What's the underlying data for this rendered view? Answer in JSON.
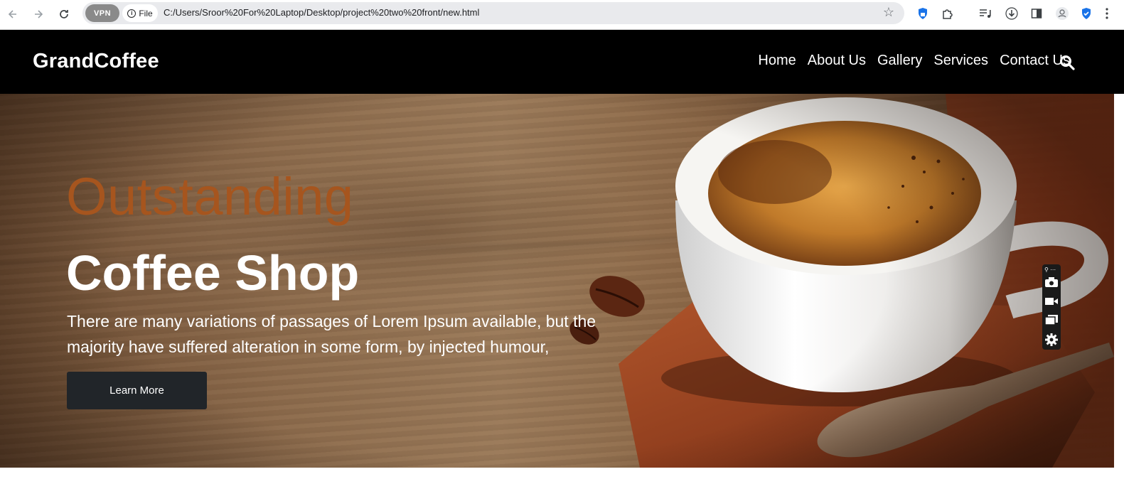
{
  "browser": {
    "vpn_label": "VPN",
    "file_label": "File",
    "url": "C:/Users/Sroor%20For%20Laptop/Desktop/project%20two%20front/new.html"
  },
  "header": {
    "brand": "GrandCoffee",
    "nav": [
      "Home",
      "About Us",
      "Gallery",
      "Services",
      "Contact Us"
    ]
  },
  "hero": {
    "title_line1": "Outstanding",
    "title_line2": "Coffee Shop",
    "description": "There are many variations of passages of Lorem Ipsum available, but the majority have suffered alteration in some form, by injected humour,",
    "cta_label": "Learn More"
  },
  "colors": {
    "header_bg": "#000000",
    "accent_text": "#a6551e",
    "cta_bg": "#212529"
  }
}
